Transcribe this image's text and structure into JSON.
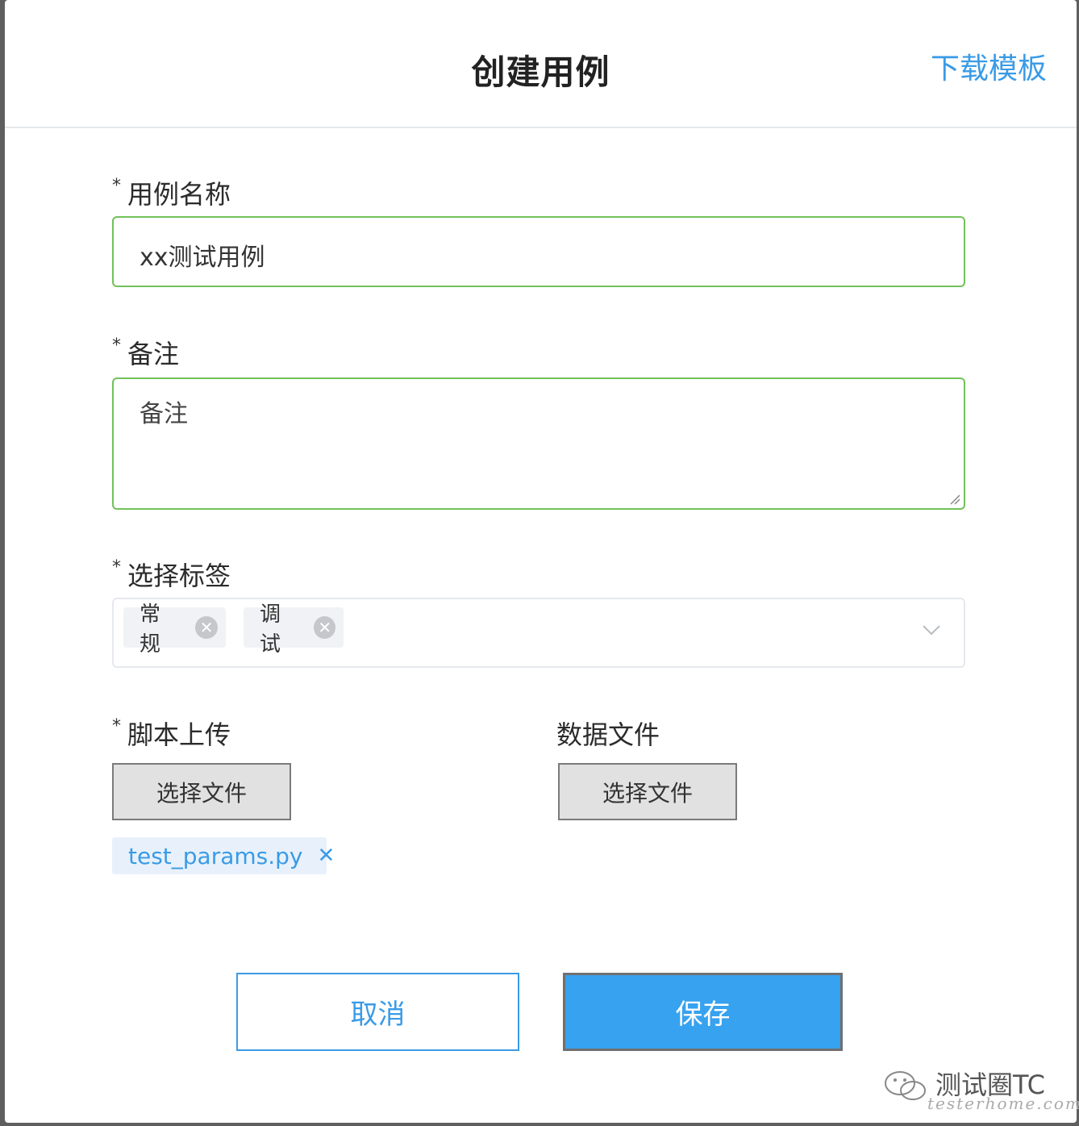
{
  "dialog": {
    "title": "创建用例",
    "download_template": "下载模板"
  },
  "form": {
    "required_mark": "*",
    "case_name": {
      "label": "用例名称",
      "value": "xx测试用例"
    },
    "remark": {
      "label": "备注",
      "placeholder": "备注"
    },
    "tags": {
      "label": "选择标签",
      "selected": [
        "常规",
        "调试"
      ]
    },
    "script_upload": {
      "label": "脚本上传",
      "button": "选择文件",
      "file": "test_params.py"
    },
    "data_file": {
      "label": "数据文件",
      "button": "选择文件"
    }
  },
  "actions": {
    "cancel": "取消",
    "save": "保存"
  },
  "watermark": {
    "text": "测试圈TC",
    "sub": "testerhome.com"
  },
  "colors": {
    "accent": "#3a9be6",
    "valid_border": "#72c15a",
    "save_bg": "#37a2ef"
  },
  "icons": [
    "close-circle-icon",
    "chevron-down-icon",
    "close-icon",
    "resize-handle-icon",
    "wechat-logo-icon"
  ]
}
